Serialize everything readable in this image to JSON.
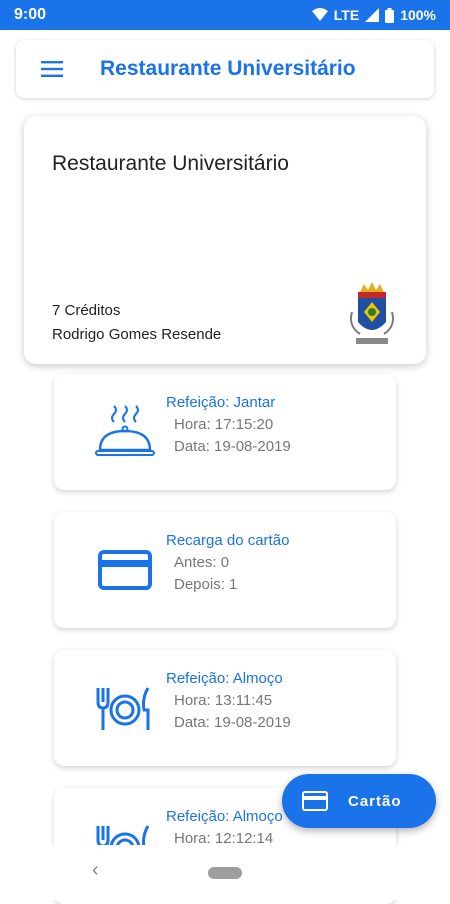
{
  "status_bar": {
    "time": "9:00",
    "network": "LTE",
    "battery": "100%"
  },
  "app_bar": {
    "title": "Restaurante Universitário"
  },
  "hero_card": {
    "title": "Restaurante Universitário",
    "credits": "7 Créditos",
    "user_name": "Rodrigo Gomes Resende"
  },
  "transactions": [
    {
      "title": "Refeição: Jantar",
      "line1": "Hora: 17:15:20",
      "line2": "Data: 19-08-2019",
      "icon": "cloche-icon"
    },
    {
      "title": "Recarga do cartão",
      "line1": "Antes: 0",
      "line2": "Depois: 1",
      "icon": "credit-card-icon"
    },
    {
      "title": "Refeição: Almoço",
      "line1": "Hora: 13:11:45",
      "line2": "Data: 19-08-2019",
      "icon": "plate-cutlery-icon"
    },
    {
      "title": "Refeição: Almoço",
      "line1": "Hora: 12:12:14",
      "line2": "",
      "icon": "plate-cutlery-icon"
    }
  ],
  "fab": {
    "label": "Cartão",
    "icon": "credit-card-icon"
  },
  "colors": {
    "primary": "#1a73e8",
    "text_secondary": "#777777"
  }
}
